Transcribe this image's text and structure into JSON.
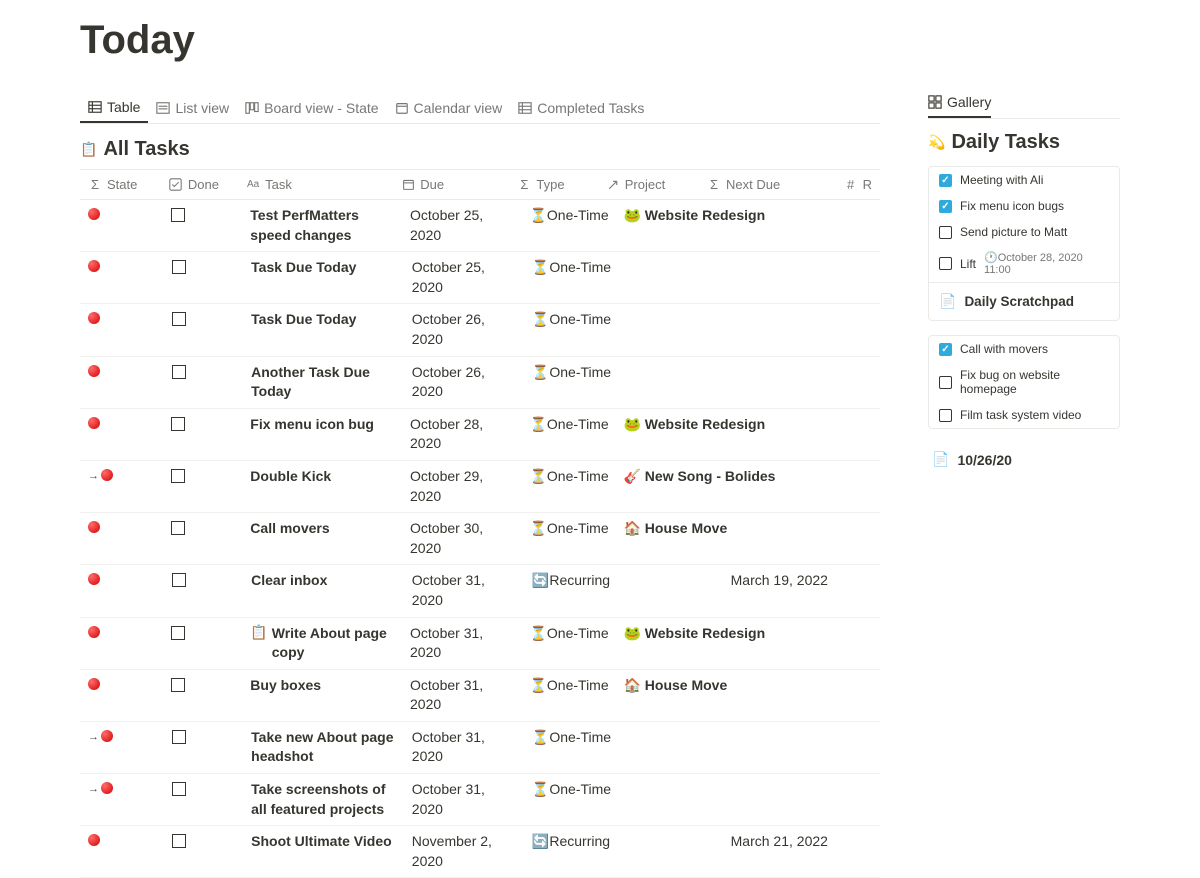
{
  "page": {
    "title": "Today"
  },
  "tabs": [
    {
      "label": "Table",
      "active": true,
      "icon": "table"
    },
    {
      "label": "List view",
      "active": false,
      "icon": "list"
    },
    {
      "label": "Board view - State",
      "active": false,
      "icon": "board"
    },
    {
      "label": "Calendar view",
      "active": false,
      "icon": "calendar"
    },
    {
      "label": "Completed Tasks",
      "active": false,
      "icon": "table"
    }
  ],
  "section": {
    "emoji": "📋",
    "title": "All Tasks"
  },
  "columns": {
    "state": "State",
    "done": "Done",
    "task": "Task",
    "due": "Due",
    "type": "Type",
    "project": "Project",
    "nextdue": "Next Due",
    "r": "R"
  },
  "rows": [
    {
      "state": "dot",
      "task": "Test PerfMatters speed changes",
      "due": "October 25, 2020",
      "type_emoji": "⏳",
      "type": "One-Time",
      "proj_emoji": "🐸",
      "project": "Website Redesign",
      "nextdue": ""
    },
    {
      "state": "dot",
      "task": "Task Due Today",
      "due": "October 25, 2020",
      "type_emoji": "⏳",
      "type": "One-Time",
      "proj_emoji": "",
      "project": "",
      "nextdue": ""
    },
    {
      "state": "dot",
      "task": "Task Due Today",
      "due": "October 26, 2020",
      "type_emoji": "⏳",
      "type": "One-Time",
      "proj_emoji": "",
      "project": "",
      "nextdue": ""
    },
    {
      "state": "dot",
      "task": "Another Task Due Today",
      "due": "October 26, 2020",
      "type_emoji": "⏳",
      "type": "One-Time",
      "proj_emoji": "",
      "project": "",
      "nextdue": ""
    },
    {
      "state": "dot",
      "task": "Fix menu icon bug",
      "due": "October 28, 2020",
      "type_emoji": "⏳",
      "type": "One-Time",
      "proj_emoji": "🐸",
      "project": "Website Redesign",
      "nextdue": ""
    },
    {
      "state": "arrow",
      "task": "Double Kick",
      "due": "October 29, 2020",
      "type_emoji": "⏳",
      "type": "One-Time",
      "proj_emoji": "🎸",
      "project": "New Song - Bolides",
      "nextdue": ""
    },
    {
      "state": "dot",
      "task": "Call movers",
      "due": "October 30, 2020",
      "type_emoji": "⏳",
      "type": "One-Time",
      "proj_emoji": "🏠",
      "project": "House Move",
      "nextdue": ""
    },
    {
      "state": "dot",
      "task": "Clear inbox",
      "due": "October 31, 2020",
      "type_emoji": "🔄",
      "type": "Recurring",
      "proj_emoji": "",
      "project": "",
      "nextdue": "March 19, 2022"
    },
    {
      "state": "dot",
      "task_emoji": "📋",
      "task": "Write About page copy",
      "due": "October 31, 2020",
      "type_emoji": "⏳",
      "type": "One-Time",
      "proj_emoji": "🐸",
      "project": "Website Redesign",
      "nextdue": ""
    },
    {
      "state": "dot",
      "task": "Buy boxes",
      "due": "October 31, 2020",
      "type_emoji": "⏳",
      "type": "One-Time",
      "proj_emoji": "🏠",
      "project": "House Move",
      "nextdue": ""
    },
    {
      "state": "arrow",
      "task": "Take new About page headshot",
      "due": "October 31, 2020",
      "type_emoji": "⏳",
      "type": "One-Time",
      "proj_emoji": "",
      "project": "",
      "nextdue": ""
    },
    {
      "state": "arrow",
      "task": "Take screenshots of all featured projects",
      "due": "October 31, 2020",
      "type_emoji": "⏳",
      "type": "One-Time",
      "proj_emoji": "",
      "project": "",
      "nextdue": ""
    },
    {
      "state": "dot",
      "task": "Shoot Ultimate Video",
      "due": "November 2, 2020",
      "type_emoji": "🔄",
      "type": "Recurring",
      "proj_emoji": "",
      "project": "",
      "nextdue": "March 21, 2022"
    }
  ],
  "sidebar": {
    "tab": "Gallery",
    "heading_emoji": "💫",
    "heading": "Daily Tasks",
    "card1": [
      {
        "checked": true,
        "label": "Meeting with Ali"
      },
      {
        "checked": true,
        "label": "Fix menu icon bugs"
      },
      {
        "checked": false,
        "label": "Send picture to Matt"
      },
      {
        "checked": false,
        "label": "Lift",
        "meta": "🕐October 28, 2020 11:00"
      }
    ],
    "card1_footer": {
      "icon": "📄",
      "label": "Daily Scratchpad"
    },
    "card2": [
      {
        "checked": true,
        "label": "Call with movers"
      },
      {
        "checked": false,
        "label": "Fix bug on website homepage"
      },
      {
        "checked": false,
        "label": "Film task system video"
      }
    ],
    "link": {
      "icon": "📄",
      "label": "10/26/20"
    }
  }
}
